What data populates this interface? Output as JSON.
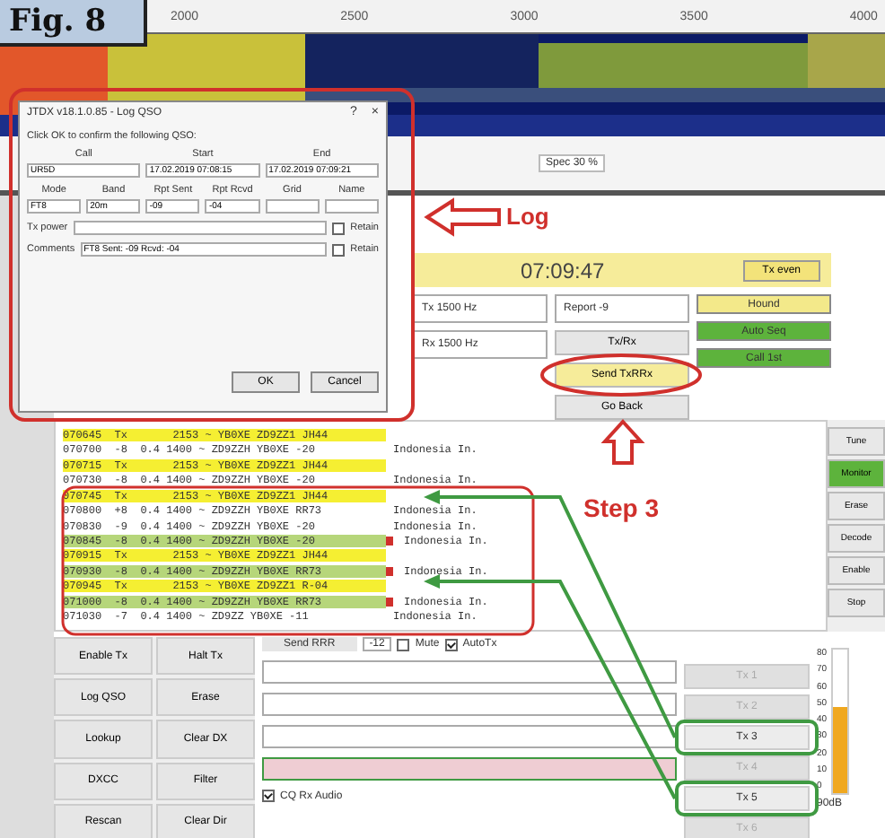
{
  "figure_label": "Fig. 8",
  "scale": [
    "2000",
    "2500",
    "3000",
    "3500",
    "4000"
  ],
  "spectrum_control": "Spec 30 %",
  "log_dialog": {
    "title": "JTDX v18.1.0.85 - Log QSO",
    "help": "?",
    "close": "×",
    "prompt": "Click OK to confirm the following QSO:",
    "fields_top": [
      {
        "label": "Call",
        "value": "UR5D"
      },
      {
        "label": "Start",
        "value": "17.02.2019 07:08:15"
      },
      {
        "label": "End",
        "value": "17.02.2019 07:09:21"
      }
    ],
    "fields_mid": [
      {
        "label": "Mode",
        "value": "FT8"
      },
      {
        "label": "Band",
        "value": "20m"
      },
      {
        "label": "Rpt Sent",
        "value": "-09"
      },
      {
        "label": "Rpt Rcvd",
        "value": "-04"
      },
      {
        "label": "Grid"
      },
      {
        "label": "Name"
      }
    ],
    "tx_power": {
      "label": "Tx power",
      "retain": "Retain",
      "checked": false
    },
    "comments": {
      "label": "Comments",
      "value": "FT8 Sent: -09 Rcvd: -04",
      "retain": "Retain",
      "checked": false
    },
    "buttons": [
      "OK",
      "Cancel"
    ]
  },
  "annotations": {
    "log": "Log",
    "step": "Step 3"
  },
  "clock": "07:09:47",
  "tx_even": "Tx even",
  "controls": [
    {
      "kind": "field",
      "text": "Tx 1500 Hz"
    },
    {
      "kind": "field",
      "text": "Rx 1500 Hz"
    }
  ],
  "report": "Report -9",
  "middle_buttons": [
    {
      "text": "Tx/Rx",
      "selected": false
    },
    {
      "text": "Send TxRRx",
      "selected": true
    },
    {
      "text": "Go Back",
      "selected": false
    }
  ],
  "right_buttons": [
    {
      "text": "Hound",
      "color": "#f3e98a"
    },
    {
      "text": "Auto Seq",
      "color": "#5db33c"
    },
    {
      "text": "Call 1st",
      "color": "#5db33c"
    }
  ],
  "decodes": [
    {
      "kind": "tx",
      "text": "070645  Tx       2153 ~ YB0XE ZD9ZZ1 JH44"
    },
    {
      "kind": "plain",
      "text": "070700  -8  0.4 1400 ~ ZD9ZZH YB0XE -20",
      "note": "Indonesia In."
    },
    {
      "kind": "tx",
      "text": "070715  Tx       2153 ~ YB0XE ZD9ZZ1 JH44"
    },
    {
      "kind": "plain",
      "text": "070730  -8  0.4 1400 ~ ZD9ZZH YB0XE -20",
      "note": "Indonesia In."
    },
    {
      "kind": "tx",
      "text": "070745  Tx       2153 ~ YB0XE ZD9ZZ1 JH44"
    },
    {
      "kind": "plain",
      "text": "070800  +8  0.4 1400 ~ ZD9ZZH YB0XE RR73",
      "note": "Indonesia In."
    },
    {
      "kind": "plain",
      "text": "070830  -9  0.4 1400 ~ ZD9ZZH YB0XE -20",
      "note": "Indonesia In."
    },
    {
      "kind": "reply",
      "text": "070845  -8  0.4 1400 ~ ZD9ZZH YB0XE -20",
      "note": "Indonesia In."
    },
    {
      "kind": "tx",
      "text": "070915  Tx       2153 ~ YB0XE ZD9ZZ1 JH44"
    },
    {
      "kind": "reply",
      "text": "070930  -8  0.4 1400 ~ ZD9ZZH YB0XE RR73",
      "note": "Indonesia In."
    },
    {
      "kind": "tx",
      "text": "070945  Tx       2153 ~ YB0XE ZD9ZZ1 R-04"
    },
    {
      "kind": "reply",
      "text": "071000  -8  0.4 1400 ~ ZD9ZZH YB0XE RR73",
      "note": "Indonesia In."
    },
    {
      "kind": "plain",
      "text": "071030  -7  0.4 1400 ~ ZD9ZZ YB0XE -11",
      "note": "Indonesia In."
    }
  ],
  "side_buttons": [
    {
      "text": "Tune",
      "selected": false
    },
    {
      "text": "Monitor",
      "selected": true
    },
    {
      "text": "Erase",
      "selected": false
    },
    {
      "text": "Decode",
      "selected": false
    },
    {
      "text": "Enable",
      "selected": false
    },
    {
      "text": "Stop",
      "selected": false
    }
  ],
  "left_buttons": [
    "Enable Tx",
    "Halt Tx",
    "Log QSO",
    "Erase",
    "Lookup",
    "Clear DX",
    "DXCC",
    "Filter",
    "Rescan",
    "Clear Dir"
  ],
  "send_row": {
    "label": "Send RRR",
    "value": "-12"
  },
  "mute": {
    "label": "Mute",
    "checked": false
  },
  "autotx": {
    "label": "AutoTx",
    "checked": true
  },
  "tx_buttons": [
    {
      "text": "Tx 1",
      "selected": false
    },
    {
      "text": "Tx 2",
      "selected": false
    },
    {
      "text": "Tx 3",
      "selected": true
    },
    {
      "text": "Tx 4",
      "selected": false
    },
    {
      "text": "Tx 5",
      "selected": true
    },
    {
      "text": "Tx 6",
      "selected": false
    }
  ],
  "tx_messages": [
    {
      "kind": "field"
    },
    {
      "kind": "field"
    },
    {
      "kind": "field"
    }
  ],
  "meter": {
    "level": 0.6,
    "reading": "90dB",
    "ticks": [
      "80",
      "70",
      "60",
      "50",
      "40",
      "30",
      "20",
      "10",
      "0"
    ]
  },
  "bottom_checkbox": {
    "label": "CQ Rx Audio",
    "checked": true
  }
}
